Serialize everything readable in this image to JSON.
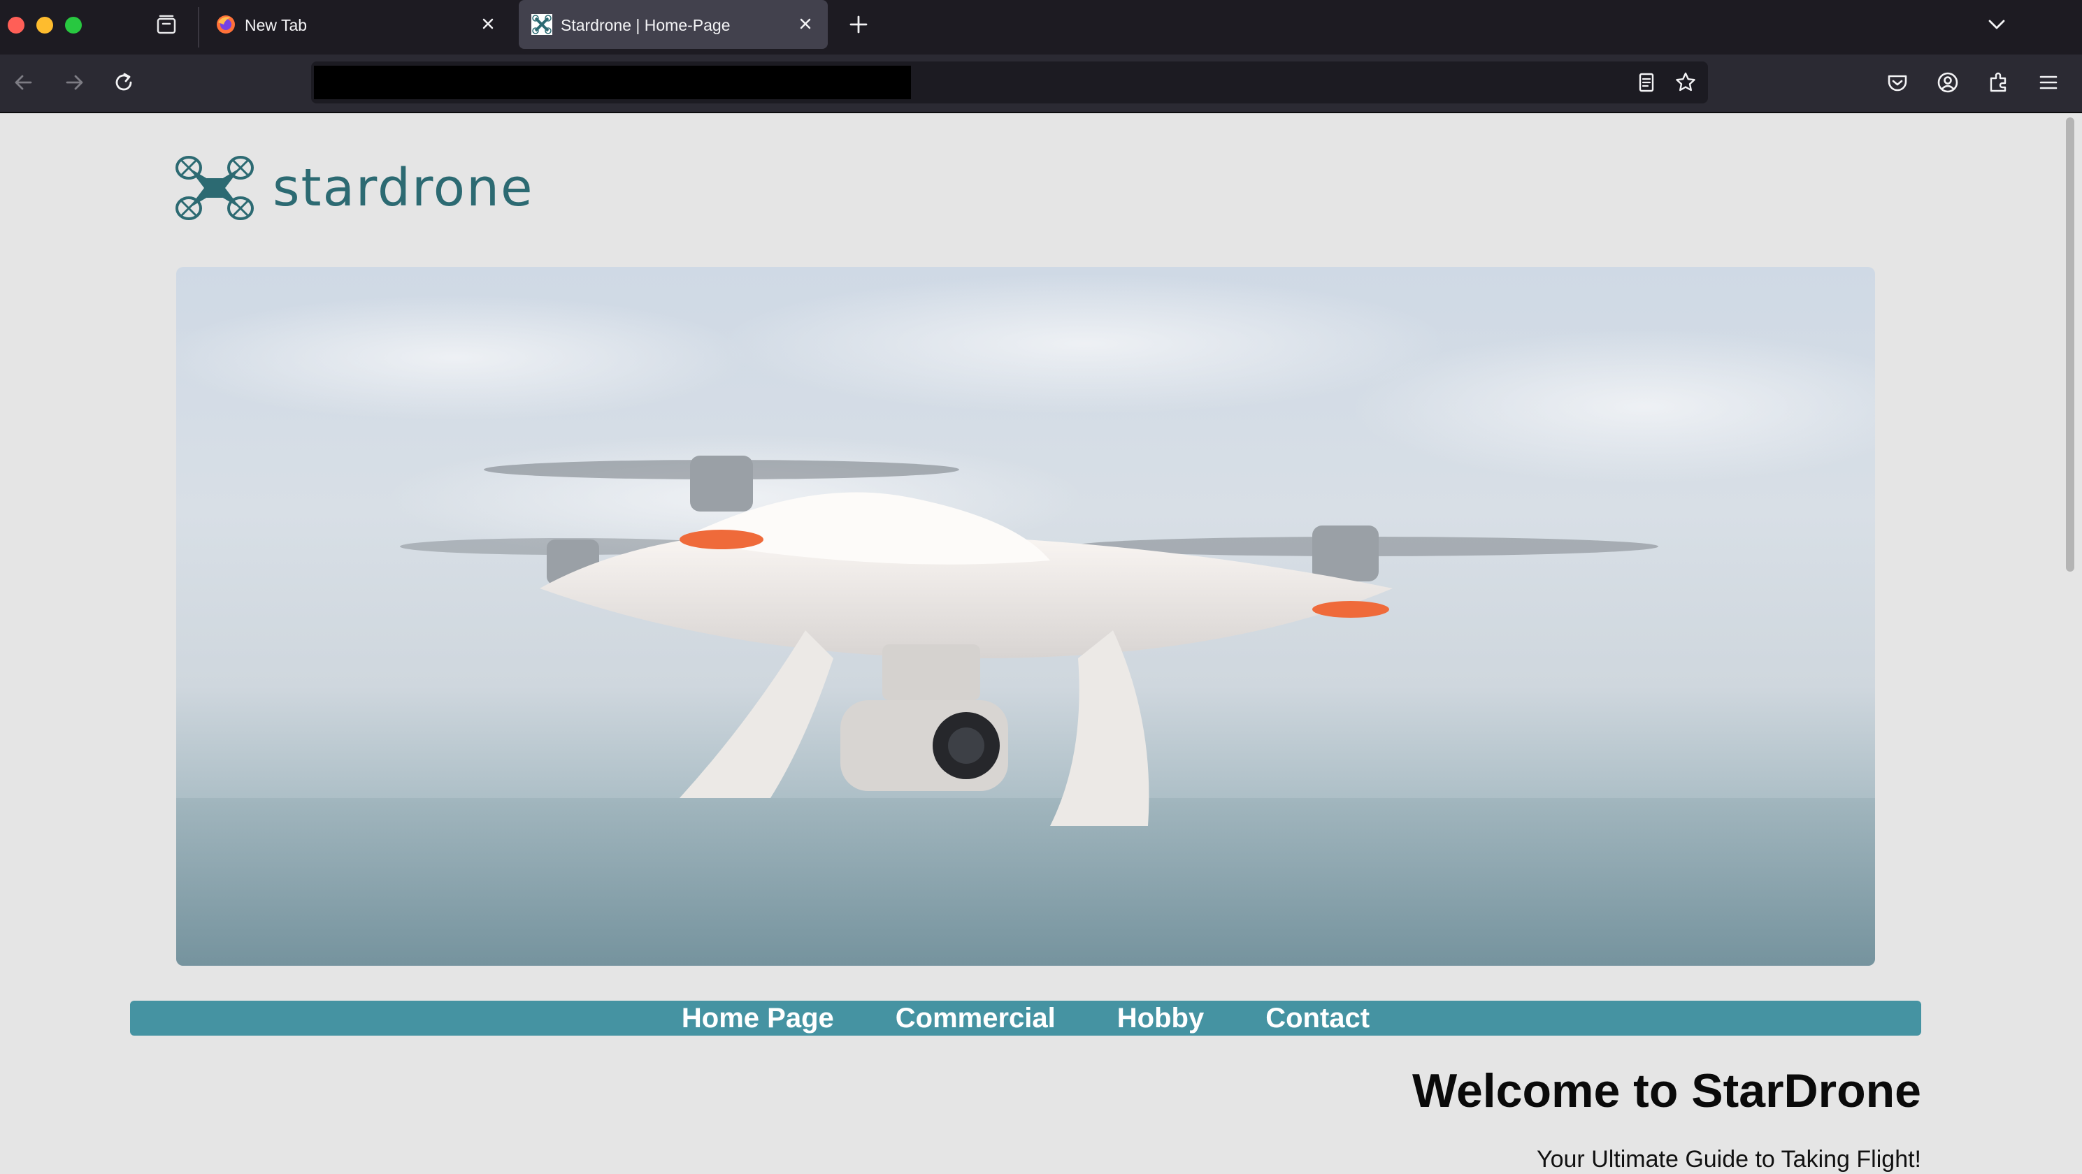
{
  "browser": {
    "tabs": [
      {
        "title": "New Tab",
        "favicon": "firefox-icon",
        "active": false
      },
      {
        "title": "Stardrone | Home-Page",
        "favicon": "stardrone-favicon",
        "active": true
      }
    ],
    "url": "",
    "toolbar_icons": [
      "back-icon",
      "forward-icon",
      "reload-icon",
      "reader-view-icon",
      "bookmark-star-icon",
      "pocket-icon",
      "account-icon",
      "extensions-icon",
      "menu-icon"
    ]
  },
  "site": {
    "logo_text": "stardrone",
    "hero_image": "white quadcopter drone flying over the sea",
    "nav": [
      {
        "label": "Home Page"
      },
      {
        "label": "Commercial"
      },
      {
        "label": "Hobby"
      },
      {
        "label": "Contact"
      }
    ],
    "welcome_heading": "Welcome to StarDrone",
    "tagline": "Your Ultimate Guide to Taking Flight!",
    "colors": {
      "brand_teal": "#2c6a72",
      "nav_bar": "#4593a2",
      "page_bg": "#e5e5e5"
    }
  }
}
